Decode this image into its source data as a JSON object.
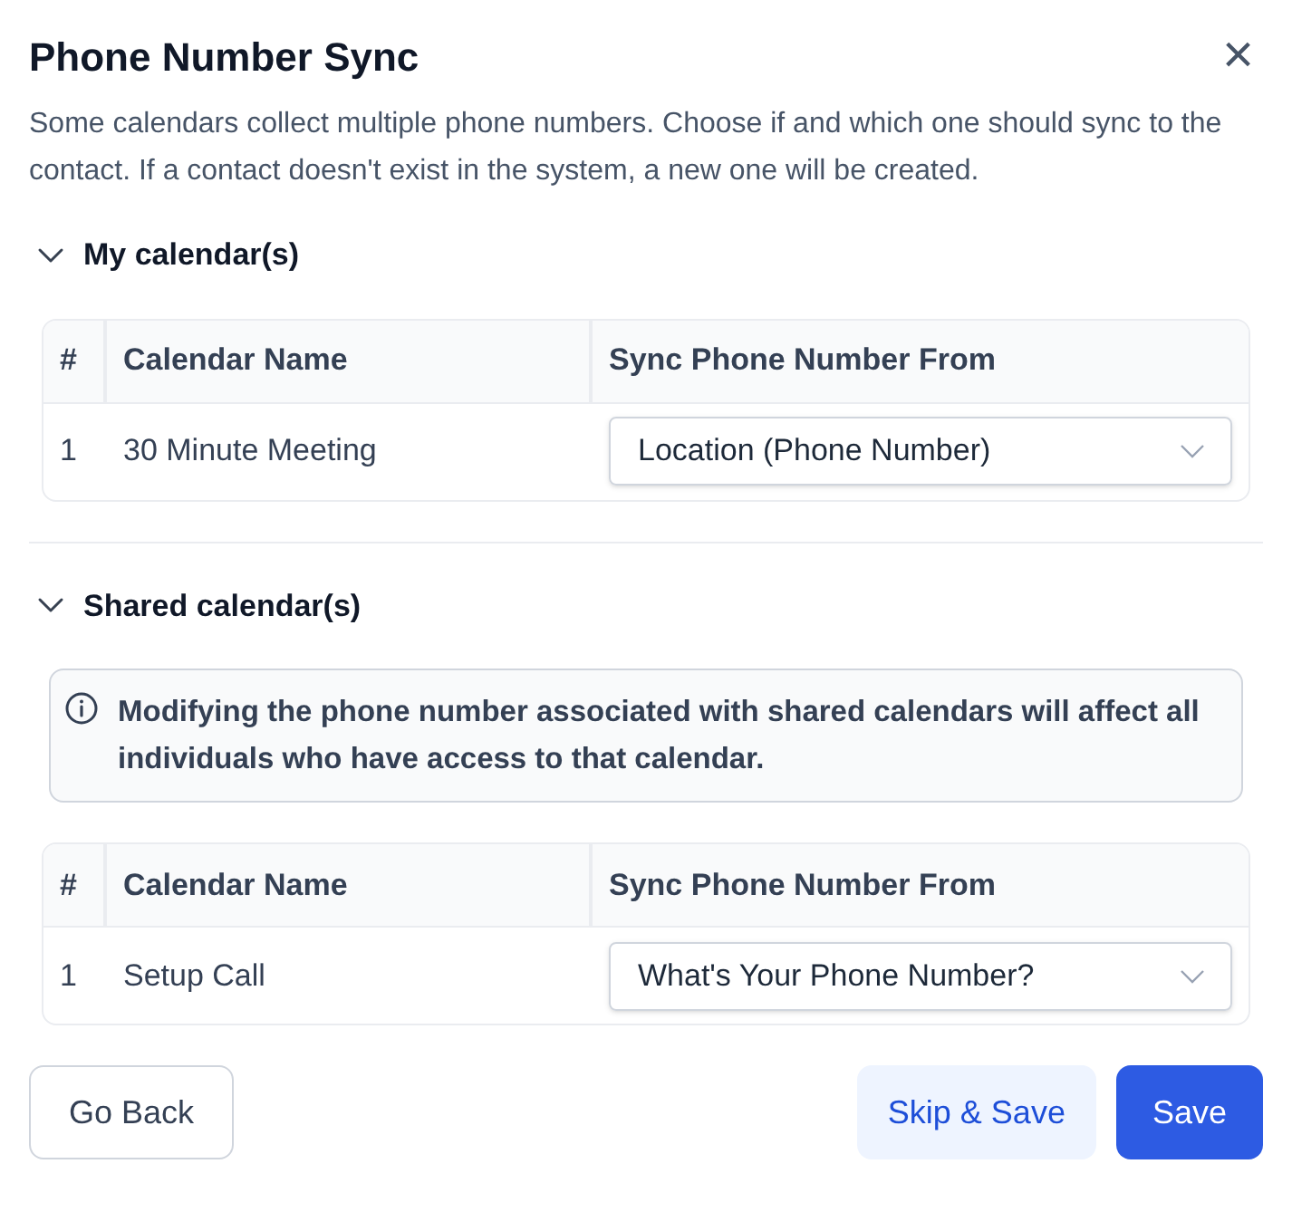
{
  "dialog": {
    "title": "Phone Number Sync",
    "close_label": "×",
    "description": "Some calendars collect multiple phone numbers. Choose if and which one should sync to the contact. If a contact doesn't exist in the system, a new one will be created."
  },
  "sections": [
    {
      "title": "My calendar(s)",
      "expanded": true,
      "columns": [
        "#",
        "Calendar Name",
        "Sync Phone Number From"
      ],
      "rows": [
        {
          "number": "1",
          "name": "30 Minute Meeting",
          "sync_from": "Location (Phone Number)"
        }
      ]
    },
    {
      "title": "Shared calendar(s)",
      "expanded": true,
      "notice": "Modifying the phone number associated with shared calendars will affect all individuals who have access to that calendar.",
      "columns": [
        "#",
        "Calendar Name",
        "Sync Phone Number From"
      ],
      "rows": [
        {
          "number": "1",
          "name": "Setup Call",
          "sync_from": "What's Your Phone Number?"
        }
      ]
    }
  ],
  "buttons": [
    {
      "label": "Go Back",
      "kind": "outline"
    },
    {
      "label": "Skip & Save",
      "kind": "soft"
    },
    {
      "label": "Save",
      "kind": "primary"
    }
  ]
}
